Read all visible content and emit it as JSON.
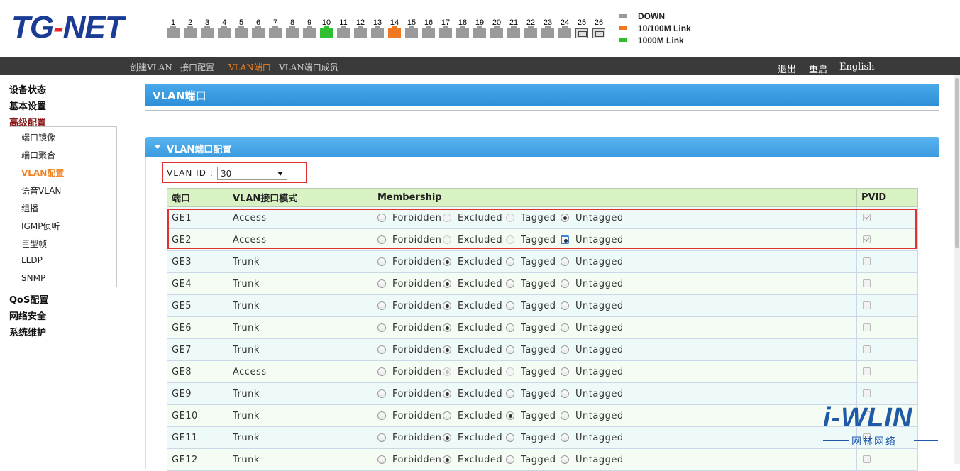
{
  "header": {
    "logo_left": "TG",
    "logo_dash": "-",
    "logo_right": "NET",
    "ports": [
      {
        "num": "1",
        "state": "down"
      },
      {
        "num": "2",
        "state": "down"
      },
      {
        "num": "3",
        "state": "down"
      },
      {
        "num": "4",
        "state": "down"
      },
      {
        "num": "5",
        "state": "down"
      },
      {
        "num": "6",
        "state": "down"
      },
      {
        "num": "7",
        "state": "down"
      },
      {
        "num": "8",
        "state": "down"
      },
      {
        "num": "9",
        "state": "down"
      },
      {
        "num": "10",
        "state": "1000m"
      },
      {
        "num": "11",
        "state": "down"
      },
      {
        "num": "12",
        "state": "down"
      },
      {
        "num": "13",
        "state": "down"
      },
      {
        "num": "14",
        "state": "100m"
      },
      {
        "num": "15",
        "state": "down"
      },
      {
        "num": "16",
        "state": "down"
      },
      {
        "num": "17",
        "state": "down"
      },
      {
        "num": "18",
        "state": "down"
      },
      {
        "num": "19",
        "state": "down"
      },
      {
        "num": "20",
        "state": "down"
      },
      {
        "num": "21",
        "state": "down"
      },
      {
        "num": "22",
        "state": "down"
      },
      {
        "num": "23",
        "state": "down"
      },
      {
        "num": "24",
        "state": "down"
      },
      {
        "num": "25",
        "state": "fiber"
      },
      {
        "num": "26",
        "state": "fiber"
      }
    ],
    "legend": [
      {
        "label": "DOWN",
        "color": "#9a9a9a"
      },
      {
        "label": "10/100M Link",
        "color": "#f07820"
      },
      {
        "label": "1000M Link",
        "color": "#2fbf30"
      }
    ]
  },
  "topnav": {
    "items": [
      "创建VLAN",
      "接口配置",
      "VLAN端口",
      "VLAN端口成员"
    ],
    "active_index": 2,
    "right": [
      "退出",
      "重启",
      "English"
    ]
  },
  "sidebar": {
    "groups": [
      "设备状态",
      "基本设置",
      "高级配置",
      "QoS配置",
      "网络安全",
      "系统维护"
    ],
    "active_group": "高级配置",
    "sub_items": [
      "端口镜像",
      "端口聚合",
      "VLAN配置",
      "语音VLAN",
      "组播",
      "IGMP侦听",
      "巨型帧",
      "LLDP",
      "SNMP"
    ],
    "active_sub": "VLAN配置"
  },
  "page": {
    "title": "VLAN端口",
    "panel_title": "VLAN端口配置",
    "vlan_id_label": "VLAN ID :",
    "vlan_id_value": "30"
  },
  "table": {
    "headers": [
      "端口",
      "VLAN接口模式",
      "Membership",
      "PVID"
    ],
    "options": [
      "Forbidden",
      "Excluded",
      "Tagged",
      "Untagged"
    ],
    "rows": [
      {
        "port": "GE1",
        "mode": "Access",
        "selected": "Untagged",
        "access": true,
        "pvid": true
      },
      {
        "port": "GE2",
        "mode": "Access",
        "selected": "Untagged",
        "access": true,
        "pvid": true,
        "focus": true
      },
      {
        "port": "GE3",
        "mode": "Trunk",
        "selected": "Excluded",
        "access": false,
        "pvid": false
      },
      {
        "port": "GE4",
        "mode": "Trunk",
        "selected": "Excluded",
        "access": false,
        "pvid": false
      },
      {
        "port": "GE5",
        "mode": "Trunk",
        "selected": "Excluded",
        "access": false,
        "pvid": false
      },
      {
        "port": "GE6",
        "mode": "Trunk",
        "selected": "Excluded",
        "access": false,
        "pvid": false
      },
      {
        "port": "GE7",
        "mode": "Trunk",
        "selected": "Excluded",
        "access": false,
        "pvid": false
      },
      {
        "port": "GE8",
        "mode": "Access",
        "selected": "Excluded",
        "access": true,
        "pvid": false
      },
      {
        "port": "GE9",
        "mode": "Trunk",
        "selected": "Excluded",
        "access": false,
        "pvid": false
      },
      {
        "port": "GE10",
        "mode": "Trunk",
        "selected": "Tagged",
        "access": false,
        "pvid": false
      },
      {
        "port": "GE11",
        "mode": "Trunk",
        "selected": "Excluded",
        "access": false,
        "pvid": false
      },
      {
        "port": "GE12",
        "mode": "Trunk",
        "selected": "Excluded",
        "access": false,
        "pvid": false
      }
    ]
  },
  "watermark": {
    "big": "i-WLIN",
    "small": "网林网络"
  }
}
